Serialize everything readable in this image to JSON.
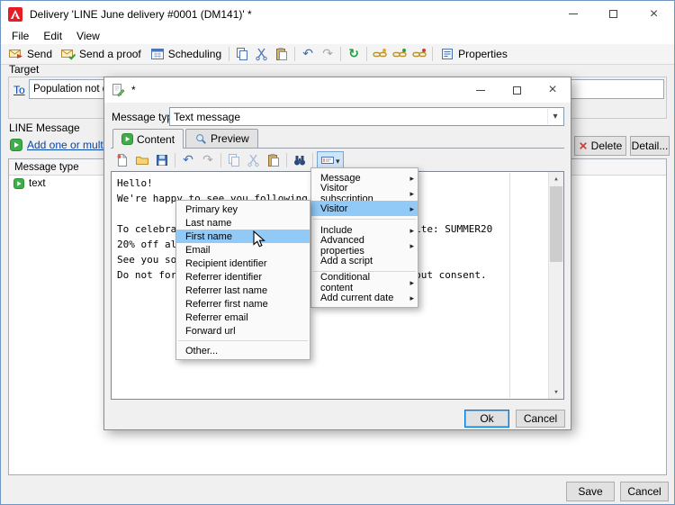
{
  "app": {
    "title": "Delivery 'LINE June delivery #0001 (DM141)' *",
    "menubar": [
      {
        "label": "File"
      },
      {
        "label": "Edit"
      },
      {
        "label": "View"
      }
    ],
    "toolbar": {
      "send": "Send",
      "send_a_proof": "Send a proof",
      "scheduling": "Scheduling",
      "properties": "Properties"
    },
    "target": {
      "section_label": "Target",
      "to_label": "To",
      "population_value": "Population not defined"
    },
    "line_message": {
      "section_label": "LINE Message",
      "add_link_label": "Add one or multipl...",
      "delete_label": "Delete",
      "detail_label": "Detail...",
      "column_header": "Message type",
      "rows": [
        {
          "type": "text"
        }
      ]
    },
    "footer": {
      "save_label": "Save",
      "cancel_label": "Cancel"
    }
  },
  "dialog": {
    "title": "*",
    "message_type_label": "Message type",
    "message_type_value": "Text message",
    "tabs": [
      {
        "label": "Content"
      },
      {
        "label": "Preview"
      }
    ],
    "editor_lines": [
      "Hello!",
      "We're happy to see you following us!",
      "",
      "To celebrate, here is a promo code to use on our site: SUMMER20",
      "20% off all our products!",
      "See you soon!",
      "Do not forget that we never send you messages without consent."
    ],
    "ok_label": "Ok",
    "cancel_label": "Cancel"
  },
  "insert_menu": {
    "items": [
      {
        "label": "Message"
      },
      {
        "label": "Visitor subscription"
      },
      {
        "label": "Visitor"
      },
      {
        "label": "Include"
      },
      {
        "label": "Advanced properties"
      },
      {
        "label": "Add a script"
      },
      {
        "label": "Conditional content"
      },
      {
        "label": "Add current date"
      }
    ]
  },
  "visitor_submenu": {
    "items": [
      {
        "label": "Primary key"
      },
      {
        "label": "Last name"
      },
      {
        "label": "First name"
      },
      {
        "label": "Email"
      },
      {
        "label": "Recipient identifier"
      },
      {
        "label": "Referrer identifier"
      },
      {
        "label": "Referrer last name"
      },
      {
        "label": "Referrer first name"
      },
      {
        "label": "Referrer email"
      },
      {
        "label": "Forward url"
      },
      {
        "label": "Other..."
      }
    ]
  },
  "colors": {
    "menu_highlight": "#91c9f7",
    "accent_blue": "#0078d7",
    "link_blue": "#0645ad",
    "green_icon": "#3fae49",
    "app_red": "#e31e26"
  }
}
